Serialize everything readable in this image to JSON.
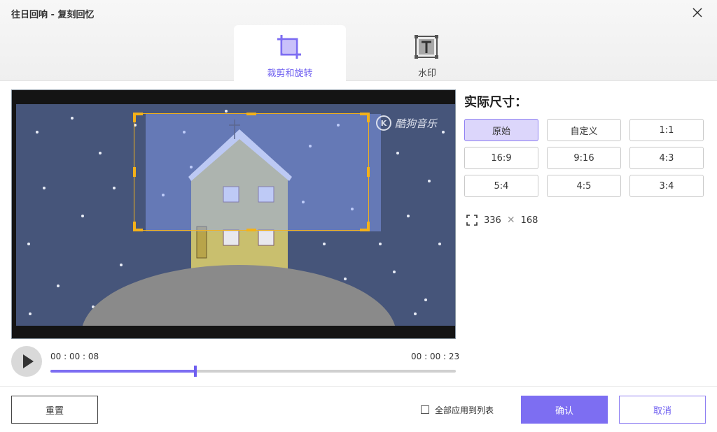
{
  "window": {
    "title": "往日回响 - 复刻回忆"
  },
  "tabs": [
    {
      "label": "裁剪和旋转",
      "icon": "crop-icon",
      "active": true
    },
    {
      "label": "水印",
      "icon": "watermark-text-icon",
      "active": false
    }
  ],
  "video": {
    "watermark": "酷狗音乐",
    "watermark_logo": "K"
  },
  "crop_panel": {
    "title": "实际尺寸：",
    "ratios": [
      "原始",
      "自定义",
      "1:1",
      "16:9",
      "9:16",
      "4:3",
      "5:4",
      "4:5",
      "3:4"
    ],
    "selected_ratio": "原始",
    "width": "336",
    "height": "168",
    "times": "✕"
  },
  "playback": {
    "current_time": "00 : 00 : 08",
    "total_time": "00 : 00 : 23",
    "progress": 0.358
  },
  "footer": {
    "reset_label": "重置",
    "apply_all_label": "全部应用到列表",
    "confirm_label": "确认",
    "cancel_label": "取消"
  },
  "colors": {
    "accent": "#7d6ef2",
    "crop_border": "#f3b21a",
    "selected_bg": "#dcd6fb"
  }
}
